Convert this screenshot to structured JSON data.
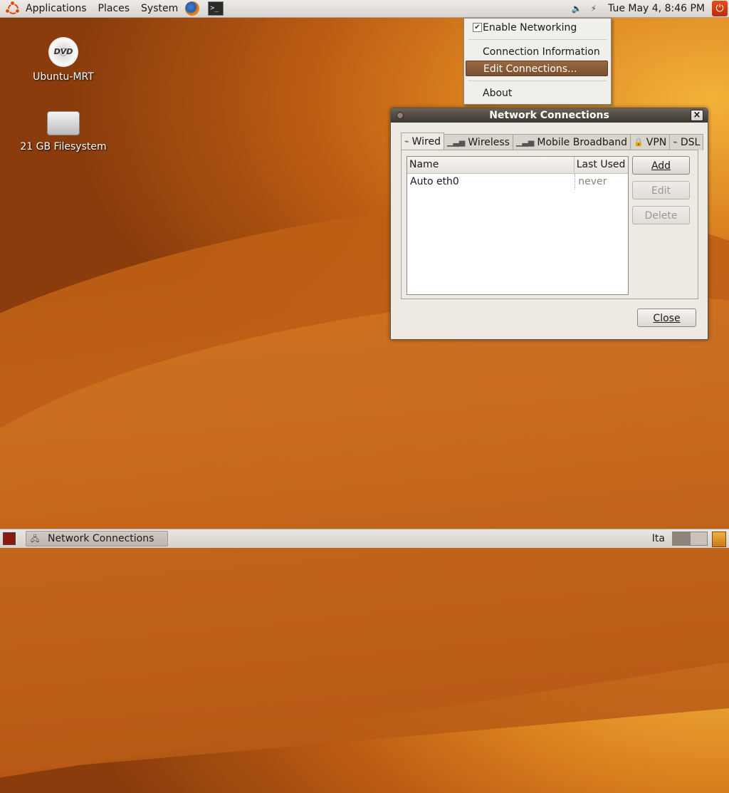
{
  "top_panel": {
    "menus": [
      "Applications",
      "Places",
      "System"
    ],
    "clock": "Tue May  4,  8:46 PM"
  },
  "desktop": {
    "icons": [
      {
        "label": "Ubuntu-MRT",
        "dvd_text": "DVD"
      },
      {
        "label": "21 GB Filesystem"
      }
    ]
  },
  "network_menu": {
    "enable_networking": "Enable Networking",
    "enable_checked": true,
    "connection_information": "Connection Information",
    "edit_connections": "Edit Connections...",
    "about": "About"
  },
  "window": {
    "title": "Network Connections",
    "tabs": [
      "Wired",
      "Wireless",
      "Mobile Broadband",
      "VPN",
      "DSL"
    ],
    "active_tab": "Wired",
    "columns": [
      "Name",
      "Last Used"
    ],
    "rows": [
      {
        "name": "Auto eth0",
        "last_used": "never"
      }
    ],
    "buttons": {
      "add": "Add",
      "edit": "Edit",
      "delete": "Delete",
      "close": "Close"
    }
  },
  "bottom_panel": {
    "task": "Network Connections",
    "keyboard": "Ita"
  }
}
